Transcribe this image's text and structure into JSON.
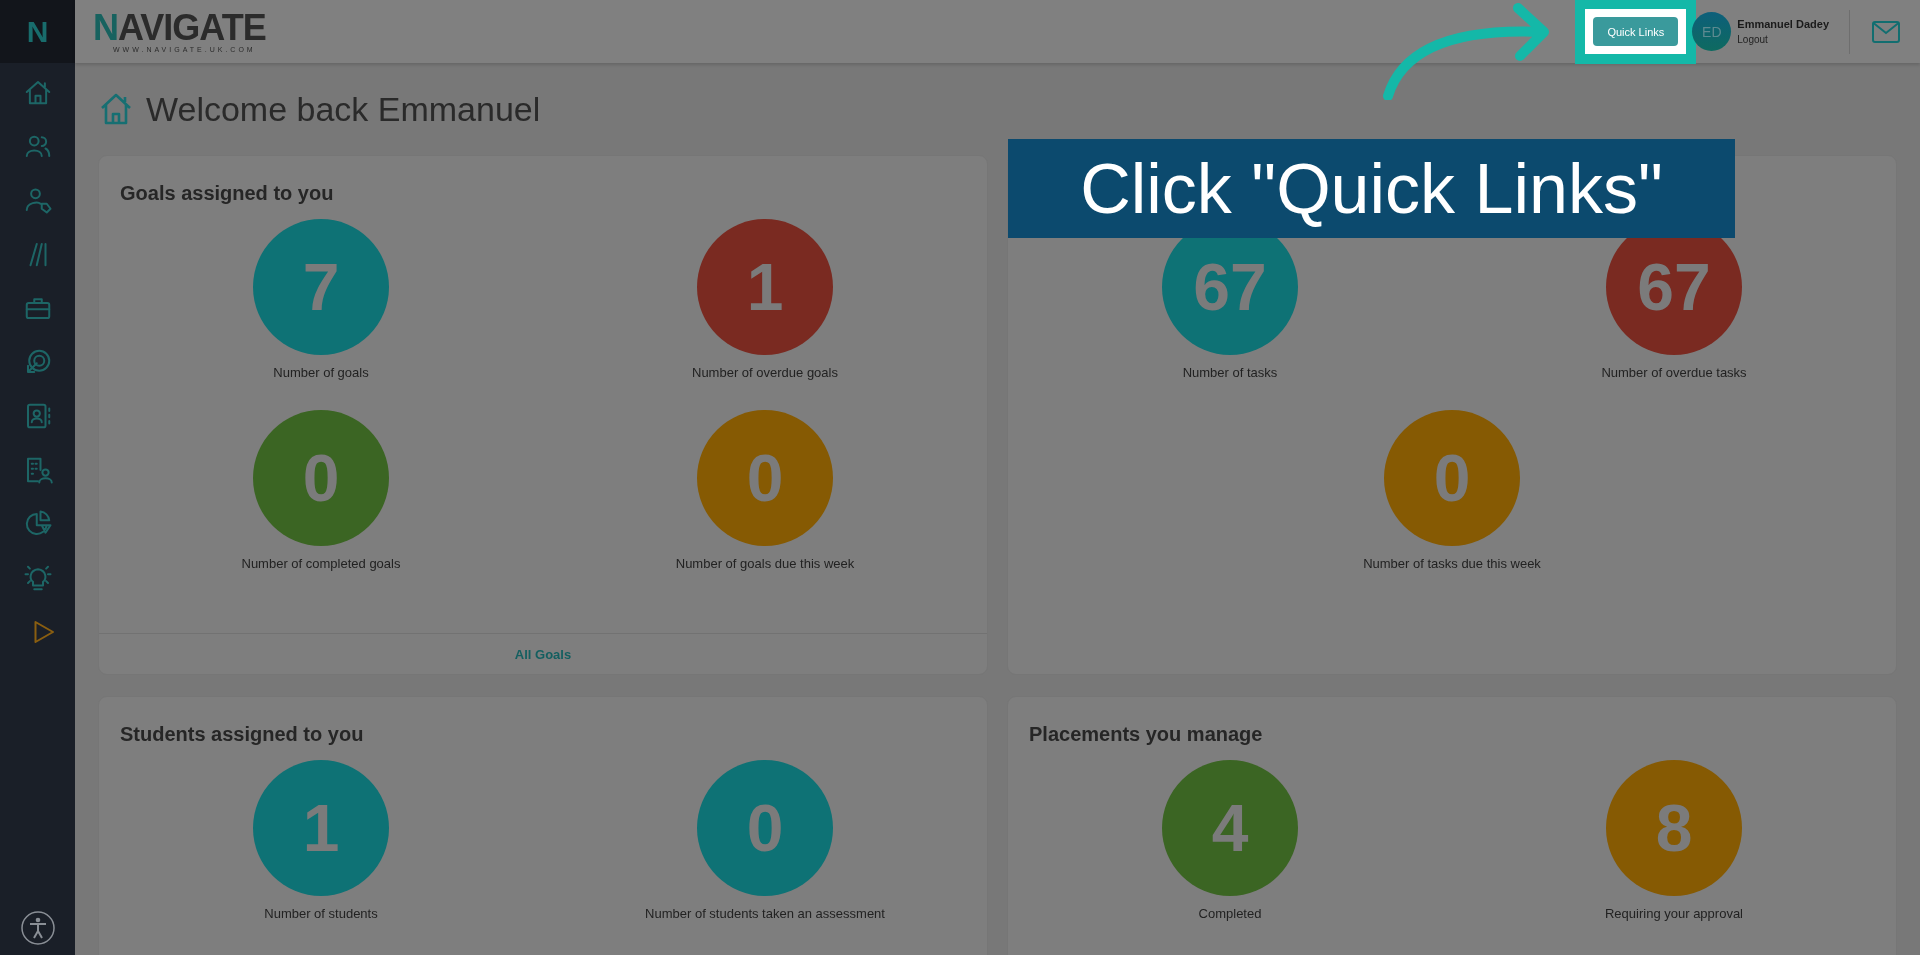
{
  "sidebar": {
    "logo": "N"
  },
  "header": {
    "logo": "NAVIGATE",
    "logo_url": "WWW.NAVIGATE.UK.COM",
    "quick_links": "Quick Links",
    "user": {
      "initials": "ED",
      "name": "Emmanuel Dadey",
      "logout": "Logout"
    }
  },
  "page_title": "Welcome back Emmanuel",
  "callout": {
    "text": "Click \"Quick Links\""
  },
  "cards": [
    {
      "title": "Goals assigned to you",
      "footer_link": "All Goals",
      "stats": [
        {
          "value": "7",
          "label": "Number of goals",
          "color": "#0e7275"
        },
        {
          "value": "1",
          "label": "Number of overdue goals",
          "color": "#7a2a21"
        },
        {
          "value": "0",
          "label": "Number of completed goals",
          "color": "#3b6523"
        },
        {
          "value": "0",
          "label": "Number of goals due this week",
          "color": "#865a03"
        }
      ]
    },
    {
      "stats": [
        {
          "value": "67",
          "label": "Number of tasks",
          "color": "#0e7275"
        },
        {
          "value": "67",
          "label": "Number of overdue tasks",
          "color": "#7a2a21"
        },
        {
          "value": "0",
          "label": "Number of tasks due this week",
          "color": "#865a03"
        }
      ]
    },
    {
      "title": "Students assigned to you",
      "stats": [
        {
          "value": "1",
          "label": "Number of students",
          "color": "#0e7275"
        },
        {
          "value": "0",
          "label": "Number of students taken an assessment",
          "color": "#0e7275"
        }
      ]
    },
    {
      "title": "Placements you manage",
      "stats": [
        {
          "value": "4",
          "label": "Completed",
          "color": "#3b6523"
        },
        {
          "value": "8",
          "label": "Requiring your approval",
          "color": "#865a03"
        }
      ]
    }
  ]
}
